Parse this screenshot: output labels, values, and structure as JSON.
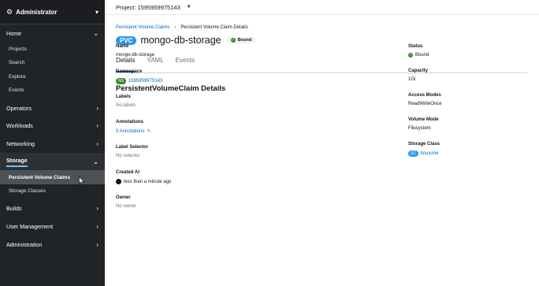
{
  "sidebar": {
    "perspective": "Administrator",
    "sections": [
      {
        "label": "Home",
        "expanded": true,
        "items": [
          "Projects",
          "Search",
          "Explore",
          "Events"
        ]
      },
      {
        "label": "Operators",
        "expanded": false
      },
      {
        "label": "Workloads",
        "expanded": false
      },
      {
        "label": "Networking",
        "expanded": false
      },
      {
        "label": "Storage",
        "expanded": true,
        "active": true,
        "items": [
          "Persistent Volume Claims",
          "Storage Classes"
        ]
      },
      {
        "label": "Builds",
        "expanded": false
      },
      {
        "label": "User Management",
        "expanded": false
      },
      {
        "label": "Administration",
        "expanded": false
      }
    ]
  },
  "topbar": {
    "project": "Project: 1595959975143"
  },
  "breadcrumb": {
    "parent": "Persistent Volume Claims",
    "current": "Persistent Volume Claim Details"
  },
  "header": {
    "kind_badge": "PVC",
    "title": "mongo-db-storage",
    "status": "Bound"
  },
  "tabs": [
    "Details",
    "YAML",
    "Events"
  ],
  "details": {
    "section_title": "PersistentVolumeClaim Details",
    "left": {
      "name_label": "Name",
      "name_value": "mongo-db-storage",
      "namespace_label": "Namespace",
      "namespace_badge": "NS",
      "namespace_value": "1595959975143",
      "labels_label": "Labels",
      "labels_value": "No labels",
      "annotations_label": "Annotations",
      "annotations_value": "3 Annotations",
      "selector_label": "Label Selector",
      "selector_value": "No selector",
      "created_label": "Created At",
      "created_value": "less than a minute ago",
      "owner_label": "Owner",
      "owner_value": "No owner"
    },
    "right": {
      "status_label": "Status",
      "status_value": "Bound",
      "capacity_label": "Capacity",
      "capacity_value": "1Gi",
      "access_label": "Access Modes",
      "access_value": "ReadWriteOnce",
      "volume_mode_label": "Volume Mode",
      "volume_mode_value": "Filesystem",
      "storage_class_label": "Storage Class",
      "storage_class_badge": "SC",
      "storage_class_value": "linuxone"
    }
  },
  "colors": {
    "sidebar_bg": "#212427",
    "link": "#0066cc",
    "success": "#3e8635",
    "pvc_badge": "#2b9af3"
  }
}
